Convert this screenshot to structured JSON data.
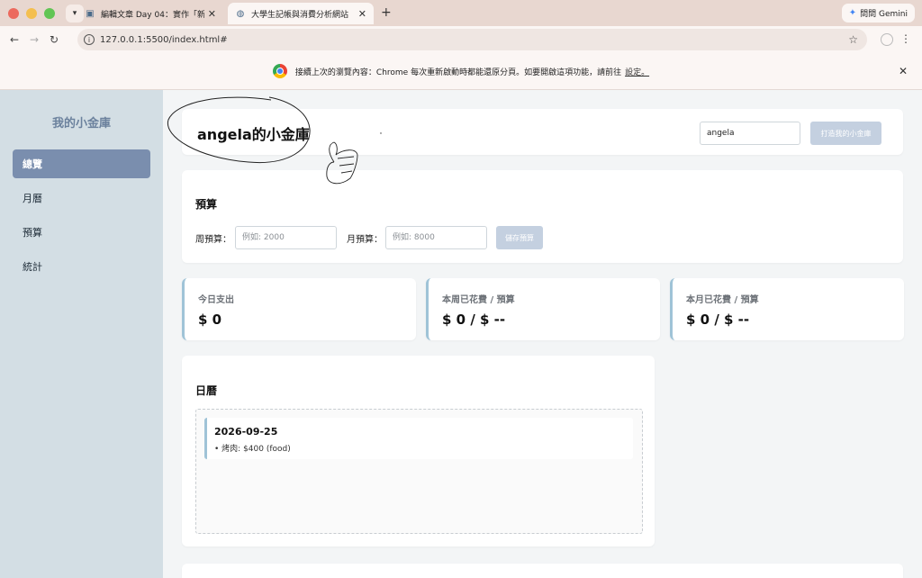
{
  "browser": {
    "tabs": [
      {
        "title": "編輯文章 Day 04：實作「新增"
      },
      {
        "title": "大學生記帳與消費分析網站"
      }
    ],
    "gemini_label": "問問 Gemini",
    "url": "127.0.0.1:5500/index.html#",
    "infobar": {
      "message": "接續上次的瀏覽內容：Chrome 每次重新啟動時都能還原分頁。如要開啟這項功能，請前往",
      "link": "設定。"
    }
  },
  "sidebar": {
    "brand": "我的小金庫",
    "items": [
      {
        "label": "總覽",
        "active": true
      },
      {
        "label": "月曆",
        "active": false
      },
      {
        "label": "預算",
        "active": false
      },
      {
        "label": "統計",
        "active": false
      }
    ]
  },
  "header": {
    "title": "angela的小金庫",
    "name_value": "angela",
    "build_button": "打造我的小金庫"
  },
  "budget": {
    "title": "預算",
    "weekly_label": "周預算：",
    "weekly_placeholder": "例如: 2000",
    "monthly_label": "月預算：",
    "monthly_placeholder": "例如: 8000",
    "save_button": "儲存預算"
  },
  "stats": [
    {
      "label": "今日支出",
      "value": "$ 0"
    },
    {
      "label": "本周已花費 / 預算",
      "value": "$ 0 / $ --"
    },
    {
      "label": "本月已花費 / 預算",
      "value": "$ 0 / $ --"
    }
  ],
  "calendar": {
    "title": "日曆",
    "entries": [
      {
        "date": "2026-09-25",
        "item": "• 烤肉: $400 (food)"
      }
    ]
  },
  "colors": {
    "sidebar_bg": "#d3dee4",
    "sidebar_active": "#7a8eae",
    "accent_border": "#9fc3d7",
    "disabled_button": "#c4d0e0"
  }
}
